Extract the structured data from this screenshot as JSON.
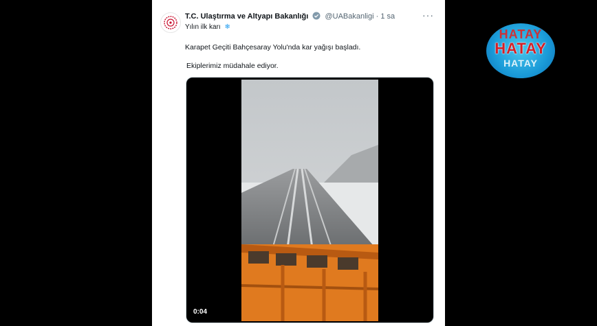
{
  "tweet": {
    "account_name": "T.C. Ulaştırma ve Altyapı Bakanlığı",
    "handle": "@UABakanligi",
    "separator": "·",
    "time": "1 sa",
    "more": "···",
    "subline": "Yılın ilk karı",
    "subline_emoji": "❄",
    "line1": "Karapet Geçiti Bahçesaray Yolu'nda kar yağışı başladı.",
    "line2": "Ekiplerimiz müdahale ediyor.",
    "video_time": "0:04"
  },
  "watermark": {
    "word": "HATAY"
  },
  "colors": {
    "background": "#000000",
    "card": "#ffffff",
    "verified": "#829aab",
    "plow": "#e07a1f",
    "logo": "#1a9ad8"
  }
}
